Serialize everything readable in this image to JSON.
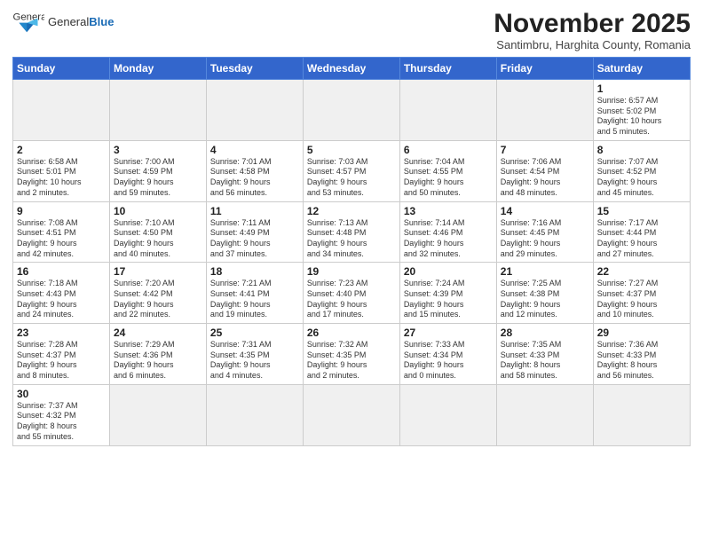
{
  "header": {
    "logo_general": "General",
    "logo_blue": "Blue",
    "month": "November 2025",
    "location": "Santimbru, Harghita County, Romania"
  },
  "days_of_week": [
    "Sunday",
    "Monday",
    "Tuesday",
    "Wednesday",
    "Thursday",
    "Friday",
    "Saturday"
  ],
  "weeks": [
    [
      {
        "day": "",
        "info": "",
        "empty": true
      },
      {
        "day": "",
        "info": "",
        "empty": true
      },
      {
        "day": "",
        "info": "",
        "empty": true
      },
      {
        "day": "",
        "info": "",
        "empty": true
      },
      {
        "day": "",
        "info": "",
        "empty": true
      },
      {
        "day": "",
        "info": "",
        "empty": true
      },
      {
        "day": "1",
        "info": "Sunrise: 6:57 AM\nSunset: 5:02 PM\nDaylight: 10 hours\nand 5 minutes."
      }
    ],
    [
      {
        "day": "2",
        "info": "Sunrise: 6:58 AM\nSunset: 5:01 PM\nDaylight: 10 hours\nand 2 minutes."
      },
      {
        "day": "3",
        "info": "Sunrise: 7:00 AM\nSunset: 4:59 PM\nDaylight: 9 hours\nand 59 minutes."
      },
      {
        "day": "4",
        "info": "Sunrise: 7:01 AM\nSunset: 4:58 PM\nDaylight: 9 hours\nand 56 minutes."
      },
      {
        "day": "5",
        "info": "Sunrise: 7:03 AM\nSunset: 4:57 PM\nDaylight: 9 hours\nand 53 minutes."
      },
      {
        "day": "6",
        "info": "Sunrise: 7:04 AM\nSunset: 4:55 PM\nDaylight: 9 hours\nand 50 minutes."
      },
      {
        "day": "7",
        "info": "Sunrise: 7:06 AM\nSunset: 4:54 PM\nDaylight: 9 hours\nand 48 minutes."
      },
      {
        "day": "8",
        "info": "Sunrise: 7:07 AM\nSunset: 4:52 PM\nDaylight: 9 hours\nand 45 minutes."
      }
    ],
    [
      {
        "day": "9",
        "info": "Sunrise: 7:08 AM\nSunset: 4:51 PM\nDaylight: 9 hours\nand 42 minutes."
      },
      {
        "day": "10",
        "info": "Sunrise: 7:10 AM\nSunset: 4:50 PM\nDaylight: 9 hours\nand 40 minutes."
      },
      {
        "day": "11",
        "info": "Sunrise: 7:11 AM\nSunset: 4:49 PM\nDaylight: 9 hours\nand 37 minutes."
      },
      {
        "day": "12",
        "info": "Sunrise: 7:13 AM\nSunset: 4:48 PM\nDaylight: 9 hours\nand 34 minutes."
      },
      {
        "day": "13",
        "info": "Sunrise: 7:14 AM\nSunset: 4:46 PM\nDaylight: 9 hours\nand 32 minutes."
      },
      {
        "day": "14",
        "info": "Sunrise: 7:16 AM\nSunset: 4:45 PM\nDaylight: 9 hours\nand 29 minutes."
      },
      {
        "day": "15",
        "info": "Sunrise: 7:17 AM\nSunset: 4:44 PM\nDaylight: 9 hours\nand 27 minutes."
      }
    ],
    [
      {
        "day": "16",
        "info": "Sunrise: 7:18 AM\nSunset: 4:43 PM\nDaylight: 9 hours\nand 24 minutes."
      },
      {
        "day": "17",
        "info": "Sunrise: 7:20 AM\nSunset: 4:42 PM\nDaylight: 9 hours\nand 22 minutes."
      },
      {
        "day": "18",
        "info": "Sunrise: 7:21 AM\nSunset: 4:41 PM\nDaylight: 9 hours\nand 19 minutes."
      },
      {
        "day": "19",
        "info": "Sunrise: 7:23 AM\nSunset: 4:40 PM\nDaylight: 9 hours\nand 17 minutes."
      },
      {
        "day": "20",
        "info": "Sunrise: 7:24 AM\nSunset: 4:39 PM\nDaylight: 9 hours\nand 15 minutes."
      },
      {
        "day": "21",
        "info": "Sunrise: 7:25 AM\nSunset: 4:38 PM\nDaylight: 9 hours\nand 12 minutes."
      },
      {
        "day": "22",
        "info": "Sunrise: 7:27 AM\nSunset: 4:37 PM\nDaylight: 9 hours\nand 10 minutes."
      }
    ],
    [
      {
        "day": "23",
        "info": "Sunrise: 7:28 AM\nSunset: 4:37 PM\nDaylight: 9 hours\nand 8 minutes."
      },
      {
        "day": "24",
        "info": "Sunrise: 7:29 AM\nSunset: 4:36 PM\nDaylight: 9 hours\nand 6 minutes."
      },
      {
        "day": "25",
        "info": "Sunrise: 7:31 AM\nSunset: 4:35 PM\nDaylight: 9 hours\nand 4 minutes."
      },
      {
        "day": "26",
        "info": "Sunrise: 7:32 AM\nSunset: 4:35 PM\nDaylight: 9 hours\nand 2 minutes."
      },
      {
        "day": "27",
        "info": "Sunrise: 7:33 AM\nSunset: 4:34 PM\nDaylight: 9 hours\nand 0 minutes."
      },
      {
        "day": "28",
        "info": "Sunrise: 7:35 AM\nSunset: 4:33 PM\nDaylight: 8 hours\nand 58 minutes."
      },
      {
        "day": "29",
        "info": "Sunrise: 7:36 AM\nSunset: 4:33 PM\nDaylight: 8 hours\nand 56 minutes."
      }
    ],
    [
      {
        "day": "30",
        "info": "Sunrise: 7:37 AM\nSunset: 4:32 PM\nDaylight: 8 hours\nand 55 minutes.",
        "last": true
      },
      {
        "day": "",
        "info": "",
        "empty": true,
        "last": true
      },
      {
        "day": "",
        "info": "",
        "empty": true,
        "last": true
      },
      {
        "day": "",
        "info": "",
        "empty": true,
        "last": true
      },
      {
        "day": "",
        "info": "",
        "empty": true,
        "last": true
      },
      {
        "day": "",
        "info": "",
        "empty": true,
        "last": true
      },
      {
        "day": "",
        "info": "",
        "empty": true,
        "last": true
      }
    ]
  ]
}
